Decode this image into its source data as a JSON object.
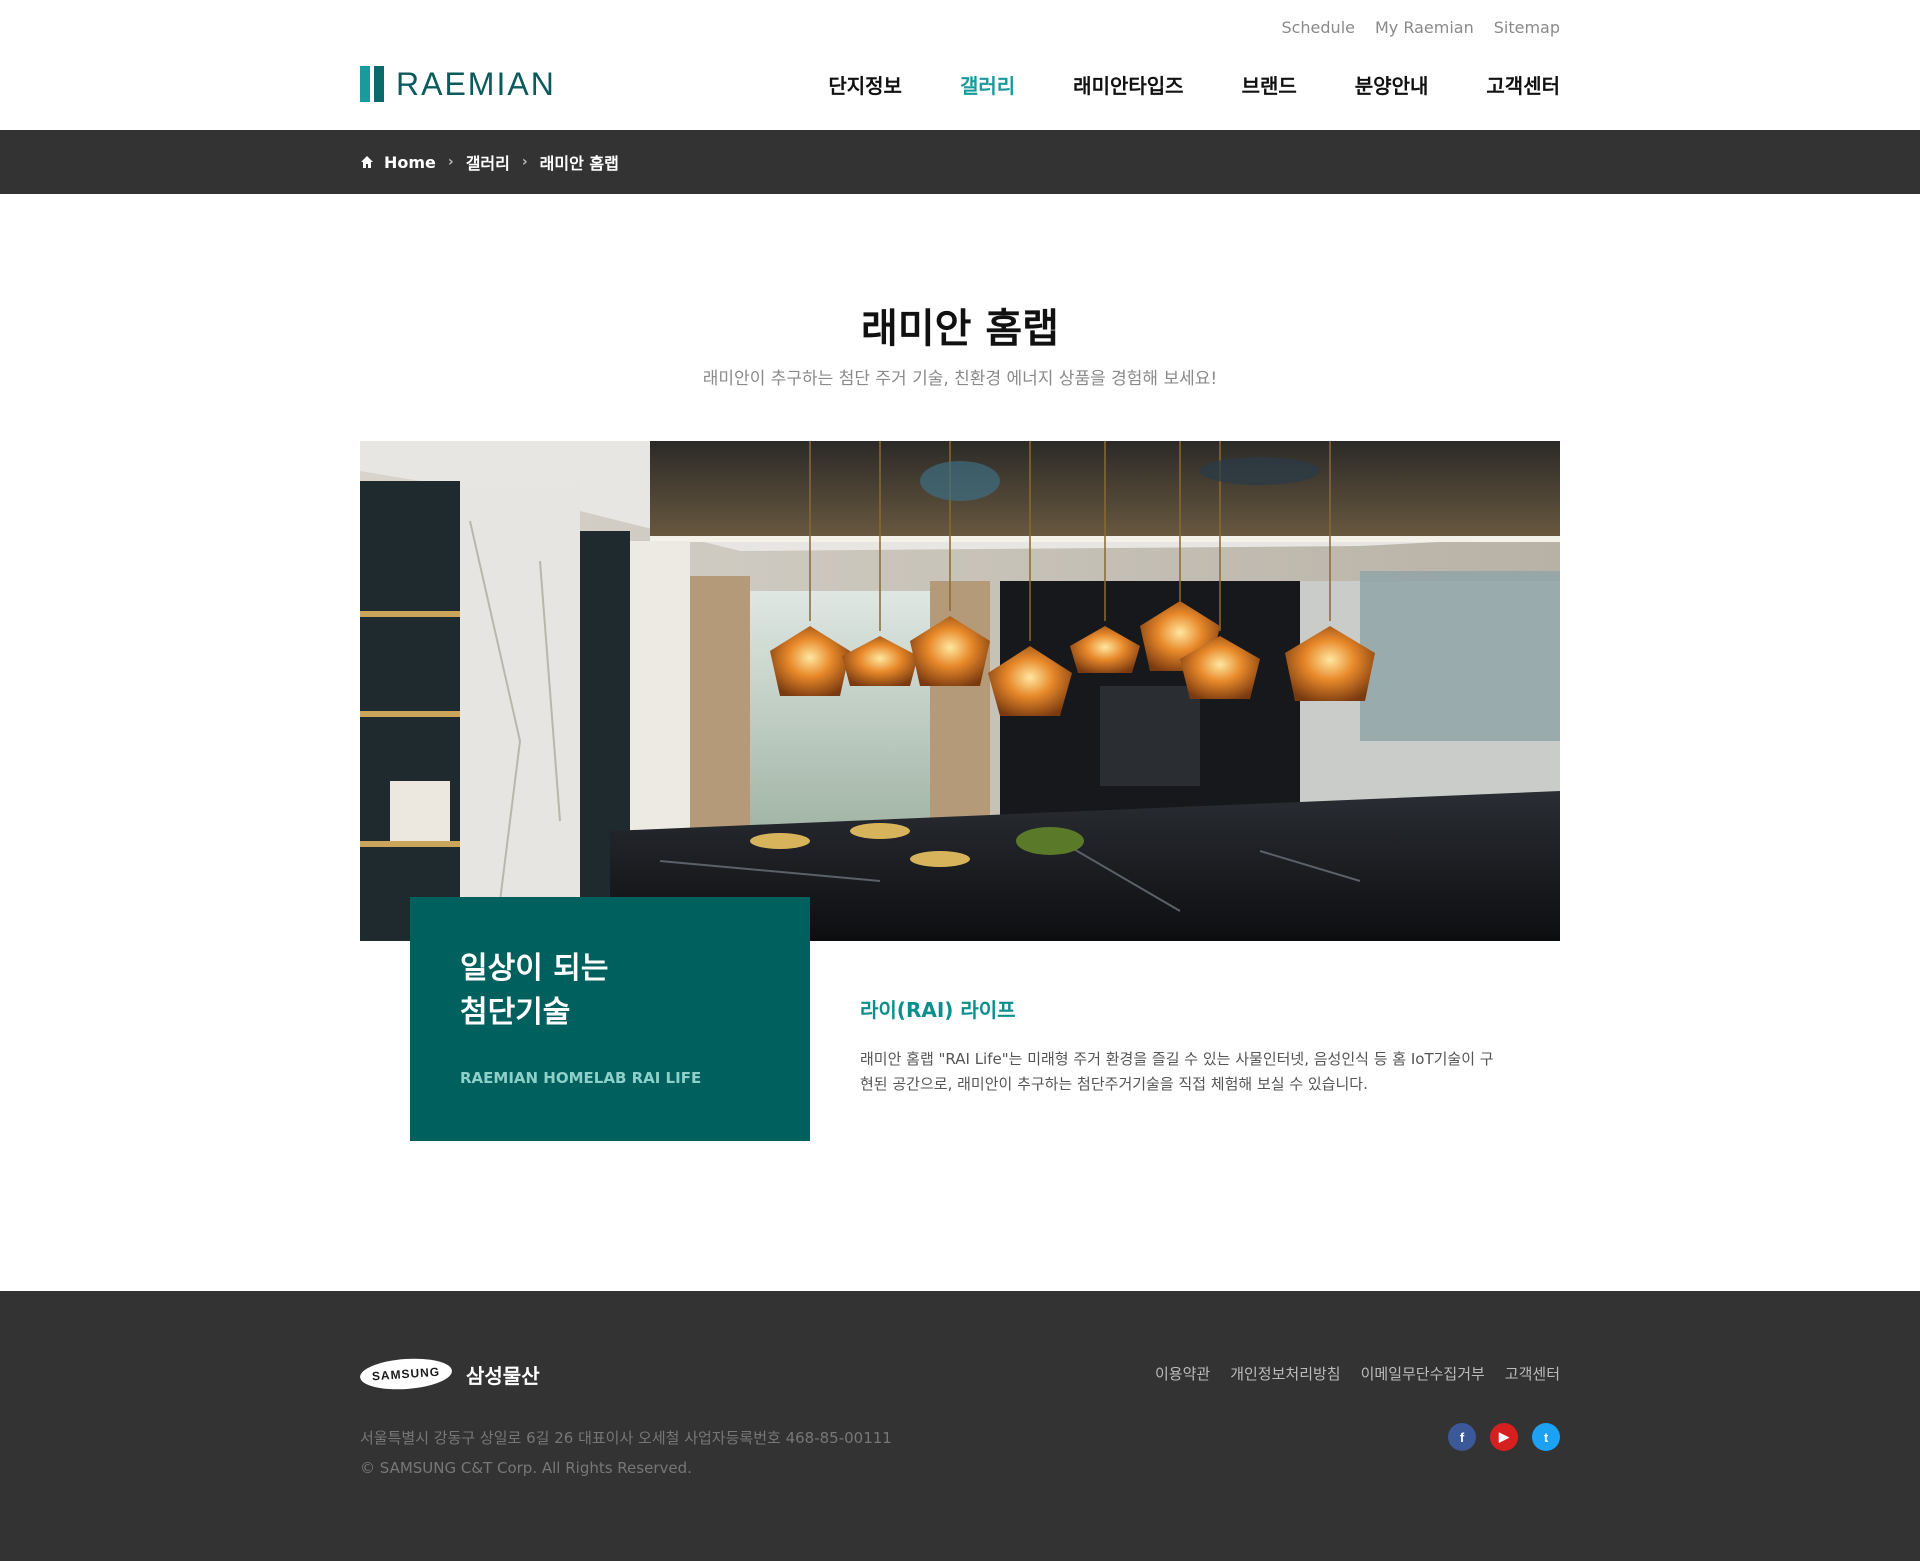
{
  "util_links": [
    "Schedule",
    "My Raemian",
    "Sitemap"
  ],
  "brand": {
    "logo_text": "RAEMIAN"
  },
  "gnb": [
    {
      "label": "단지정보",
      "active": false
    },
    {
      "label": "갤러리",
      "active": true
    },
    {
      "label": "래미안타입즈",
      "active": false
    },
    {
      "label": "브랜드",
      "active": false
    },
    {
      "label": "분양안내",
      "active": false
    },
    {
      "label": "고객센터",
      "active": false
    }
  ],
  "breadcrumb": {
    "home": "Home",
    "level1": "갤러리",
    "level2": "래미안 홈랩"
  },
  "page": {
    "title": "래미안 홈랩",
    "subtitle": "래미안이 추구하는 첨단 주거 기술, 친환경 에너지 상품을 경험해 보세요!"
  },
  "feature": {
    "heading_line1": "일상이 되는",
    "heading_line2": "첨단기술",
    "en": "RAEMIAN HOMELAB RAI LIFE"
  },
  "description": {
    "title": "라이(RAI) 라이프",
    "body_line1": "래미안 홈랩 \"RAI Life\"는 미래형 주거 환경을 즐길 수 있는 사물인터넷, 음성인식 등 홈 IoT기술이 구",
    "body_line2": "현된 공간으로, 래미안이 추구하는 첨단주거기술을 직접 체험해 보실 수 있습니다."
  },
  "footer": {
    "samsung_logo": "SAMSUNG",
    "company_kr": "삼성물산",
    "links": [
      "이용약관",
      "개인정보처리방침",
      "이메일무단수집거부",
      "고객센터"
    ],
    "address": "서울특별시 강동구 상일로 6길 26 대표이사 오세철 사업자등록번호 468-85-00111",
    "copyright": "© SAMSUNG C&T Corp. All Rights Reserved.",
    "sns": [
      "facebook-icon",
      "youtube-icon",
      "twitter-icon"
    ]
  },
  "colors": {
    "accent": "#1a9a9c",
    "feature_bg": "#00605e",
    "dark_bar": "#333333"
  }
}
